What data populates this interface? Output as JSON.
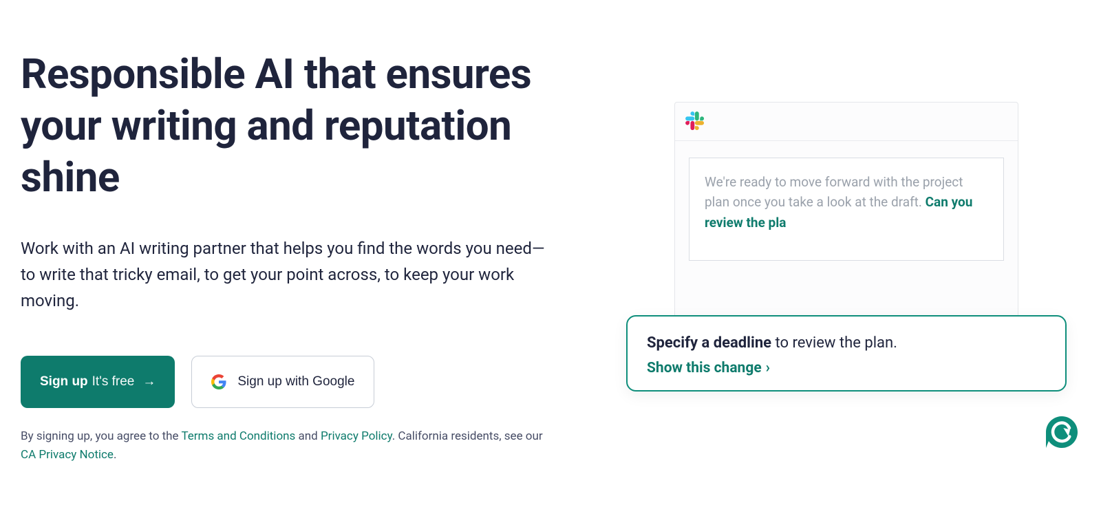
{
  "hero": {
    "headline": "Responsible AI that ensures your writing and reputation shine",
    "subhead": "Work with an AI writing partner that helps you find the words you need—to write that tricky email, to get your point across, to keep your work moving."
  },
  "cta": {
    "primary_bold": "Sign up",
    "primary_light": "It's free",
    "primary_arrow": "→",
    "google_label": "Sign up with Google"
  },
  "legal": {
    "prefix": "By signing up, you agree to the ",
    "terms": "Terms and Conditions",
    "and": " and ",
    "privacy": "Privacy Policy",
    "ca_prefix": ". California residents, see our ",
    "ca_notice": "CA Privacy Notice",
    "suffix": "."
  },
  "mock": {
    "draft_plain": "We're ready to move forward with the project plan once you take a look at the draft. ",
    "draft_typed": "Can you review the pla"
  },
  "suggestion": {
    "strong": "Specify a deadline",
    "rest": " to review the plan.",
    "link": "Show this change",
    "chevron": "›"
  },
  "icons": {
    "slack": "slack-icon",
    "grammarly": "grammarly-icon",
    "google": "google-icon"
  },
  "colors": {
    "accent": "#0e7b6c",
    "heading": "#1f243c"
  }
}
